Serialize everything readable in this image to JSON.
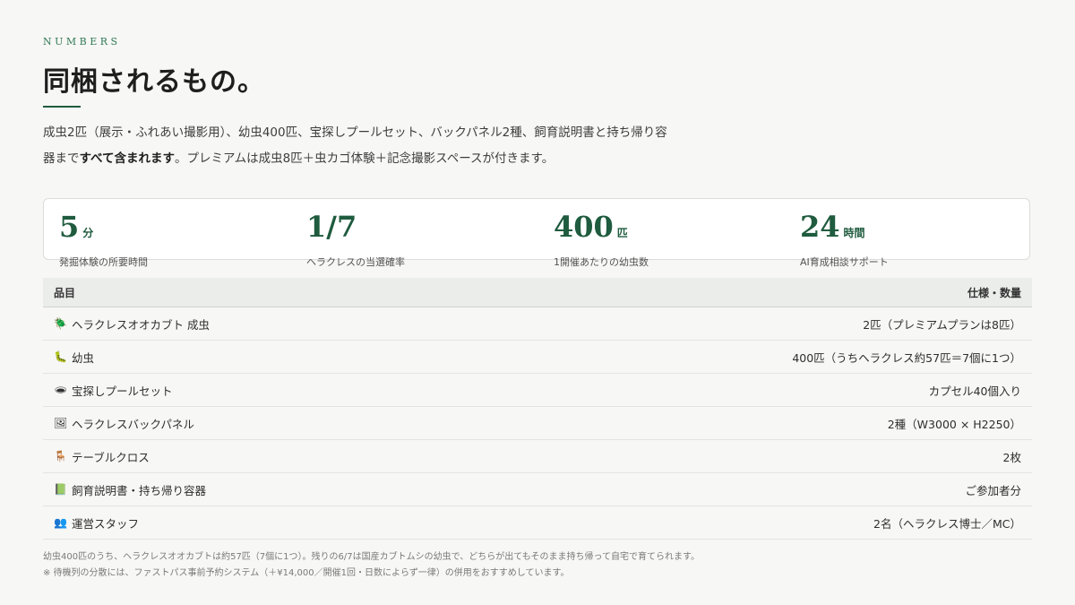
{
  "section": {
    "eyebrow": "NUMBERS",
    "title": "同梱されるもの。",
    "lead_before": "成虫2匹（展示・ふれあい撮影用）、幼虫400匹、宝探しプールセット、バックパネル2種、飼育説明書と持ち帰り容器まで",
    "lead_bold": "すべて含まれます",
    "lead_after": "。プレミアムは成虫8匹＋虫カゴ体験＋記念撮影スペースが付きます。"
  },
  "stats": [
    {
      "value": "5",
      "unit": "分",
      "label": "発掘体験の所要時間"
    },
    {
      "value": "1/7",
      "unit": "",
      "label": "ヘラクレスの当選確率"
    },
    {
      "value": "400",
      "unit": "匹",
      "label": "1開催あたりの幼虫数"
    },
    {
      "value": "24",
      "unit": "時間",
      "label": "AI育成相談サポート"
    }
  ],
  "table": {
    "header_item": "品目",
    "header_spec": "仕様・数量",
    "rows": [
      {
        "icon": "🪲",
        "icon_name": "beetle-icon",
        "item": "ヘラクレスオオカブト 成虫",
        "spec": "2匹（プレミアムプランは8匹）"
      },
      {
        "icon": "🐛",
        "icon_name": "larva-icon",
        "item": "幼虫",
        "spec": "400匹（うちヘラクレス約57匹＝7個に1つ）"
      },
      {
        "icon": "🕳",
        "icon_name": "hole-icon",
        "item": "宝探しプールセット",
        "spec": "カプセル40個入り"
      },
      {
        "icon": "🖼",
        "icon_name": "picture-icon",
        "item": "ヘラクレスバックパネル",
        "spec": "2種（W3000 × H2250）"
      },
      {
        "icon": "🪑",
        "icon_name": "chair-icon",
        "item": "テーブルクロス",
        "spec": "2枚"
      },
      {
        "icon": "📗",
        "icon_name": "book-icon",
        "item": "飼育説明書・持ち帰り容器",
        "spec": "ご参加者分"
      },
      {
        "icon": "👥",
        "icon_name": "people-icon",
        "item": "運営スタッフ",
        "spec": "2名（ヘラクレス博士／MC）"
      }
    ]
  },
  "notes": [
    "幼虫400匹のうち、ヘラクレスオオカブトは約57匹（7個に1つ）。残りの6/7は国産カブトムシの幼虫で、どちらが出てもそのまま持ち帰って自宅で育てられます。",
    "※ 待機列の分散には、ファストパス事前予約システム（＋¥14,000／開催1回・日数によらず一律）の併用をおすすめしています。"
  ]
}
